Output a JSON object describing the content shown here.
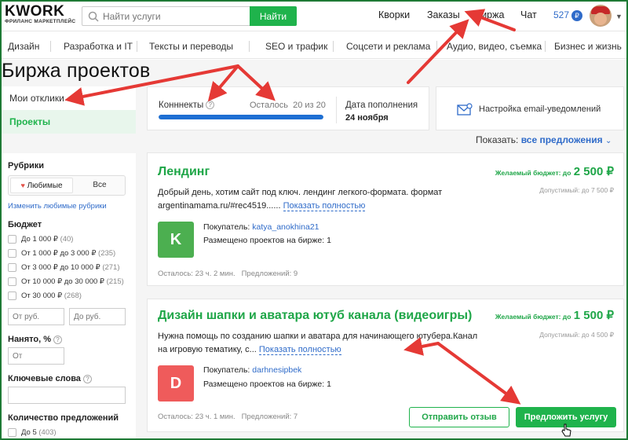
{
  "header": {
    "logo": "KWORK",
    "logo_sub": "ФРИЛАНС МАРКЕТПЛЕЙС",
    "search_placeholder": "Найти услуги",
    "search_button": "Найти",
    "nav": [
      "Кворки",
      "Заказы",
      "Биржа",
      "Чат"
    ],
    "balance": "527",
    "currency_symbol": "₽"
  },
  "categories": [
    "Дизайн",
    "Разработка и IT",
    "Тексты и переводы",
    "SEO и трафик",
    "Соцсети и реклама",
    "Аудио, видео, съемка",
    "Бизнес и жизнь"
  ],
  "page_title": "Биржа проектов",
  "side_menu": [
    "Мои отклики",
    "Проекты"
  ],
  "filters": {
    "rubrics_title": "Рубрики",
    "favorites_tab": "Любимые",
    "all_tab": "Все",
    "change_link": "Изменить любимые рубрики",
    "budget_title": "Бюджет",
    "budget_options": [
      {
        "label": "До 1 000 ₽",
        "count": "(40)"
      },
      {
        "label": "От 1 000 ₽ до 3 000 ₽",
        "count": "(235)"
      },
      {
        "label": "От 3 000 ₽ до 10 000 ₽",
        "count": "(271)"
      },
      {
        "label": "От 10 000 ₽ до 30 000 ₽",
        "count": "(215)"
      },
      {
        "label": "От 30 000 ₽",
        "count": "(268)"
      }
    ],
    "from_placeholder": "От руб.",
    "to_placeholder": "До руб.",
    "hired_title": "Нанято, %",
    "hired_placeholder": "От",
    "keywords_title": "Ключевые слова",
    "offers_title": "Количество предложений",
    "offers_first": "До 5",
    "offers_first_count": "(403)"
  },
  "stats": {
    "connects_label": "Конннекты",
    "remaining_label": "Осталось",
    "remaining_value": "20 из 20",
    "progress": 1.0,
    "date_label": "Дата пополнения",
    "date_value": "24 ноября",
    "email_settings": "Настройка email-уведомлений"
  },
  "show": {
    "label": "Показать:",
    "value": "все предложения"
  },
  "projects": [
    {
      "title": "Лендинг",
      "budget_label": "Желаемый бюджет: до",
      "budget_value": "2 500 ₽",
      "max_budget": "Допустимый: до 7 500 ₽",
      "description": "Добрый день, хотим сайт под ключ. лендинг легкого-формата. формат argentinamama.ru/#rec4519......",
      "more": "Показать полностью",
      "buyer_letter": "K",
      "buyer_label": "Покупатель:",
      "buyer_name": "katya_anokhina21",
      "posted": "Размещено проектов на бирже: 1",
      "remaining": "Осталось: 23 ч. 2 мин.",
      "offers": "Предложений: 9"
    },
    {
      "title": "Дизайн шапки и аватара ютуб канала (видеоигры)",
      "budget_label": "Желаемый бюджет: до",
      "budget_value": "1 500 ₽",
      "max_budget": "Допустимый: до 4 500 ₽",
      "description": "Нужна помощь по созданию шапки и аватара для начинающего ютубера.Канал на игровую тематику, с...",
      "more": "Показать полностью",
      "buyer_letter": "D",
      "buyer_label": "Покупатель:",
      "buyer_name": "darhnesipbek",
      "posted": "Размещено проектов на бирже: 1",
      "remaining": "Осталось: 23 ч. 1 мин.",
      "offers": "Предложений: 7",
      "btn_feedback": "Отправить отзыв",
      "btn_offer": "Предложить услугу"
    }
  ],
  "colors": {
    "brand_green": "#1fb34c",
    "link_blue": "#2f6bc9",
    "arrow_red": "#e53935",
    "avatar_k": "#4caf50",
    "avatar_d": "#ef5b5b"
  }
}
